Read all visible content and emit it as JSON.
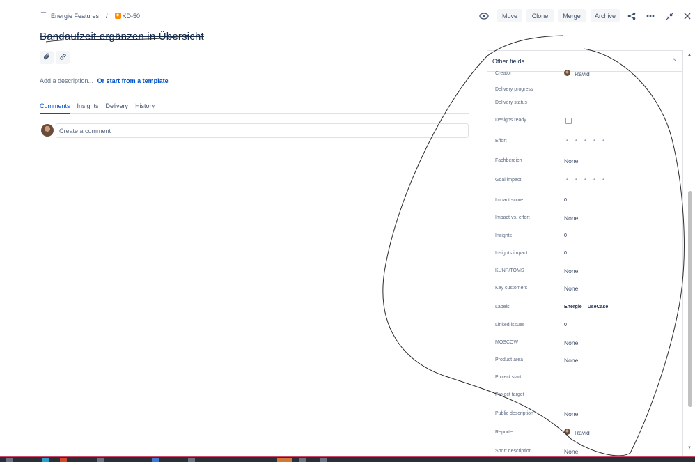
{
  "breadcrumb": {
    "project": "Energie Features",
    "separator": "/",
    "issue_key": "KD-50"
  },
  "toolbar": {
    "move": "Move",
    "clone": "Clone",
    "merge": "Merge",
    "archive": "Archive"
  },
  "issue": {
    "title": "Bandaufzeit ergänzen in Übersicht"
  },
  "description": {
    "placeholder": "Add a description...",
    "template_link": "Or start from a template"
  },
  "tabs": [
    "Comments",
    "Insights",
    "Delivery",
    "History"
  ],
  "comment": {
    "placeholder": "Create a comment"
  },
  "panel": {
    "title": "Other fields",
    "fields": [
      {
        "label": "Creator",
        "value": "Ravid"
      },
      {
        "label": "Delivery progress",
        "value": ""
      },
      {
        "label": "Delivery status",
        "value": ""
      },
      {
        "label": "Designs ready",
        "value": ""
      },
      {
        "label": "Effort",
        "value": "• • • • •"
      },
      {
        "label": "Fachbereich",
        "value": "None"
      },
      {
        "label": "Goal impact",
        "value": "• • • • •"
      },
      {
        "label": "Impact score",
        "value": "0"
      },
      {
        "label": "Impact vs. effort",
        "value": "None"
      },
      {
        "label": "Insights",
        "value": "0"
      },
      {
        "label": "Insights impact",
        "value": "0"
      },
      {
        "label": "KUNP/TOMS",
        "value": "None"
      },
      {
        "label": "Key customers",
        "value": "None"
      },
      {
        "label": "Labels",
        "value": "",
        "labels": [
          "Energie",
          "UseCase"
        ]
      },
      {
        "label": "Linked issues",
        "value": "0"
      },
      {
        "label": "MOSCOW",
        "value": "None"
      },
      {
        "label": "Product area",
        "value": "None"
      },
      {
        "label": "Project start",
        "value": ""
      },
      {
        "label": "Project target",
        "value": ""
      },
      {
        "label": "Public description",
        "value": "None"
      },
      {
        "label": "Reporter",
        "value": "Ravid"
      },
      {
        "label": "Short description",
        "value": "None"
      }
    ]
  },
  "colors": {
    "accent": "#0052cc",
    "text": "#172b4d",
    "muted": "#5e6c84",
    "issue_icon": "#ff8b00"
  },
  "icons": [
    "list-icon",
    "eye-icon",
    "share-icon",
    "more-icon",
    "minimize-icon",
    "close-icon",
    "attachment-icon",
    "link-icon",
    "chevron-up-icon"
  ]
}
